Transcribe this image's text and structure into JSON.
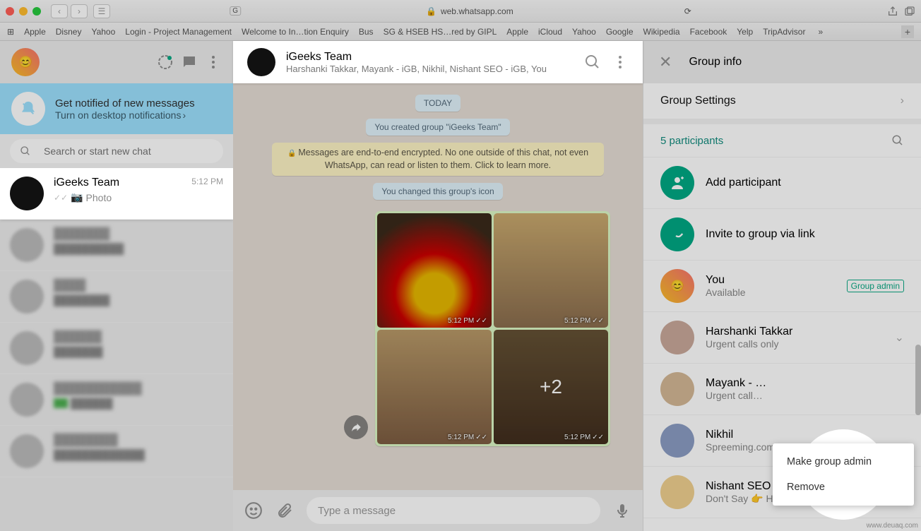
{
  "browser": {
    "url_text": "web.whatsapp.com",
    "bookmarks": [
      "Apple",
      "Disney",
      "Yahoo",
      "Login - Project Management",
      "Welcome to In…tion Enquiry",
      "Bus",
      "SG & HSEB HS…red by GIPL",
      "Apple",
      "iCloud",
      "Yahoo",
      "Google",
      "Wikipedia",
      "Facebook",
      "Yelp",
      "TripAdvisor"
    ]
  },
  "left": {
    "notification_title": "Get notified of new messages",
    "notification_action": "Turn on desktop notifications",
    "search_placeholder": "Search or start new chat",
    "active_chat": {
      "title": "iGeeks Team",
      "time": "5:12 PM",
      "subtitle": "Photo"
    }
  },
  "middle": {
    "chat_title": "iGeeks Team",
    "chat_subtitle": "Harshanki Takkar, Mayank - iGB, Nikhil, Nishant SEO - iGB, You",
    "today_label": "TODAY",
    "created_group": "You created group \"iGeeks Team\"",
    "encryption_notice": "Messages are end-to-end encrypted. No one outside of this chat, not even WhatsApp, can read or listen to them. Click to learn more.",
    "icon_changed": "You changed this group's icon",
    "photo_time": "5:12 PM",
    "extra_photos": "+2",
    "input_placeholder": "Type a message"
  },
  "right": {
    "header": "Group info",
    "settings_label": "Group Settings",
    "participants_count": "5 participants",
    "add_participant": "Add participant",
    "invite_link": "Invite to group via link",
    "admin_badge": "Group admin",
    "members": [
      {
        "name": "You",
        "status": "Available",
        "admin": true
      },
      {
        "name": "Harshanki Takkar",
        "status": "Urgent calls only"
      },
      {
        "name": "Mayank - …",
        "status": "Urgent call…"
      },
      {
        "name": "Nikhil",
        "status": "Spreeming.com"
      },
      {
        "name": "Nishant SEO - iGB",
        "status": "Don't Say 👉 Hi & Come To The Point ✌️"
      }
    ],
    "context_menu": {
      "make_admin": "Make group admin",
      "remove": "Remove"
    }
  },
  "watermark": "www.deuaq.com"
}
